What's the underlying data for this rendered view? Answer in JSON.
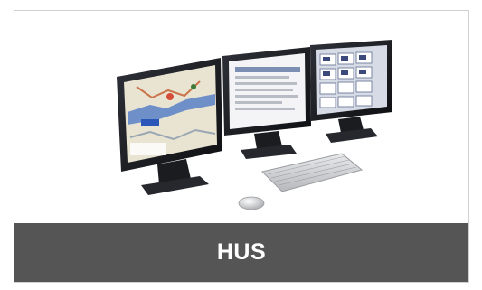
{
  "card": {
    "caption": "HUS",
    "image_icon": "three-monitor-workstation-icon"
  },
  "colors": {
    "caption_bar": "#555555",
    "caption_text": "#ffffff",
    "card_border": "#d0d0d0"
  }
}
